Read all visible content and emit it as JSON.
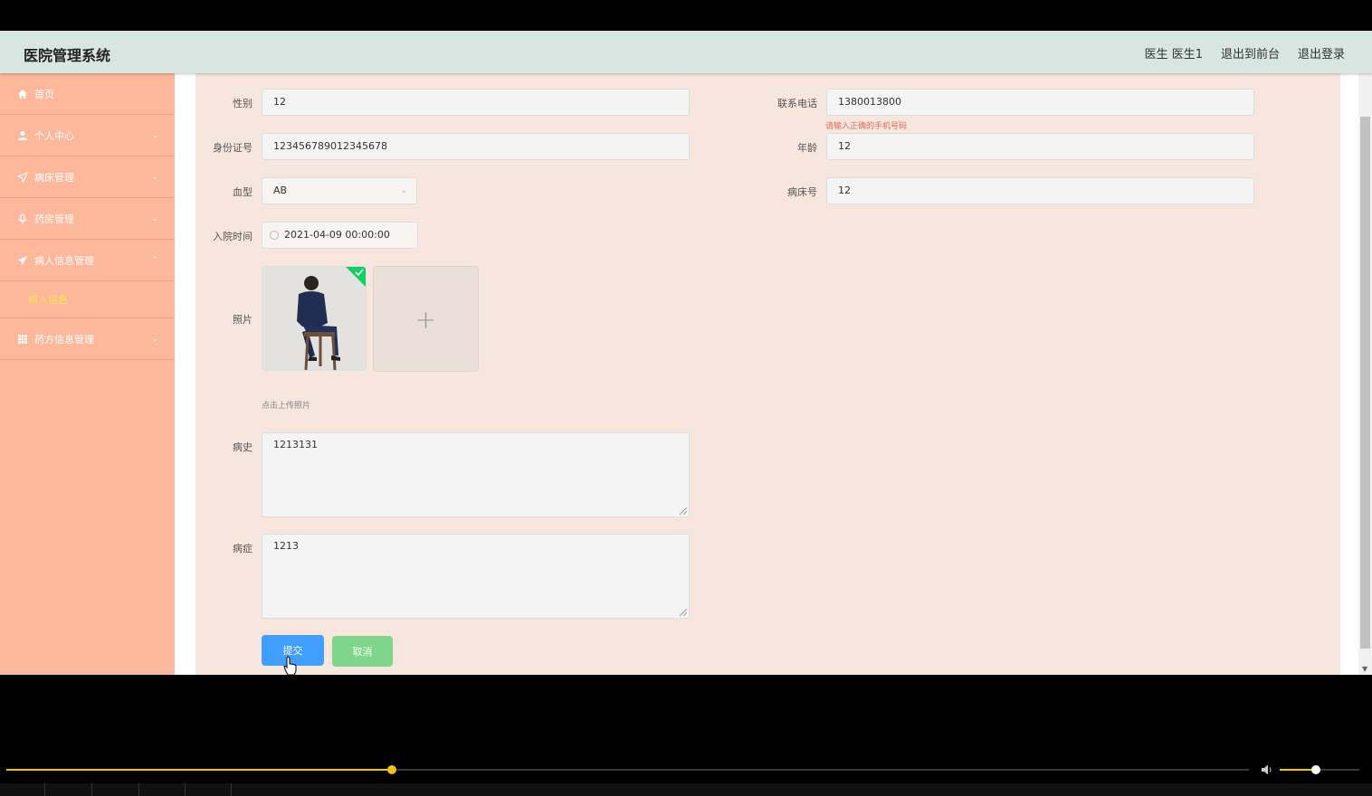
{
  "header": {
    "app_title": "医院管理系统",
    "user_label": "医生 医生1",
    "front_link": "退出到前台",
    "logout_link": "退出登录"
  },
  "sidebar": {
    "items": [
      {
        "label": "首页",
        "icon": "home-icon"
      },
      {
        "label": "个人中心",
        "icon": "user-icon"
      },
      {
        "label": "病床管理",
        "icon": "send-icon"
      },
      {
        "label": "药房管理",
        "icon": "microphone-icon"
      },
      {
        "label": "病人信息管理",
        "icon": "paper-plane-icon",
        "expanded": true
      },
      {
        "label": "药方信息管理",
        "icon": "grid-icon"
      }
    ],
    "sub_item": "病人信息"
  },
  "form": {
    "gender": {
      "label": "性别",
      "value": "12"
    },
    "phone": {
      "label": "联系电话",
      "value": "1380013800",
      "error": "请输入正确的手机号码"
    },
    "id_card": {
      "label": "身份证号",
      "value": "123456789012345678"
    },
    "age": {
      "label": "年龄",
      "value": "12"
    },
    "blood_type": {
      "label": "血型",
      "value": "AB"
    },
    "bed_no": {
      "label": "病床号",
      "value": "12"
    },
    "admit_time": {
      "label": "入院时间",
      "value": "2021-04-09 00:00:00"
    },
    "photo": {
      "label": "照片",
      "hint": "点击上传照片"
    },
    "history": {
      "label": "病史",
      "value": "1213131"
    },
    "symptom": {
      "label": "病症",
      "value": "1213"
    }
  },
  "buttons": {
    "submit": "提交",
    "cancel": "取消"
  },
  "player": {
    "progress": 0.31,
    "volume": 0.45
  },
  "colors": {
    "sidebar": "#fdb79b",
    "header": "#d7e6e0",
    "content": "#f6e6dd",
    "submit": "#409eff",
    "cancel": "#7fd68b",
    "accent": "#f1c40f"
  }
}
